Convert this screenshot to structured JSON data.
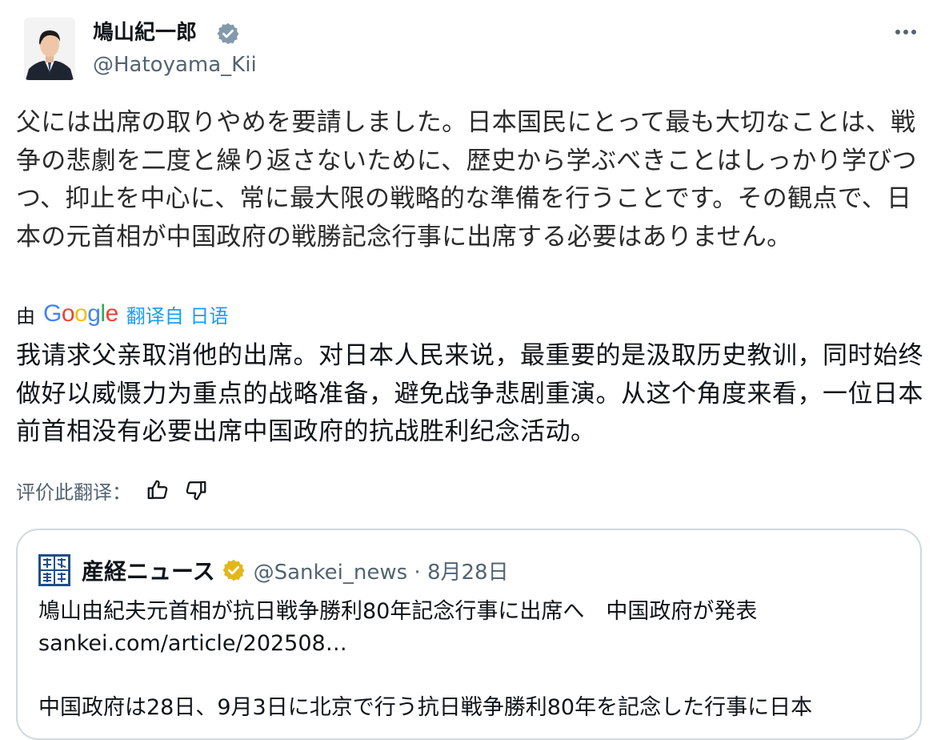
{
  "author": {
    "name": "鳩山紀一郎",
    "handle": "@Hatoyama_Kii"
  },
  "tweet": {
    "text": "父には出席の取りやめを要請しました。日本国民にとって最も大切なことは、戦争の悲劇を二度と繰り返さないために、歴史から学ぶべきことはしっかり学びつつ、抑止を中心に、常に最大限の戦略的な準備を行うことです。その観点で、日本の元首相が中国政府の戦勝記念行事に出席する必要はありません。",
    "translation_prefix": "由",
    "translation_provider": "Google",
    "translation_source": "翻译自 日语",
    "translated_text": "我请求父亲取消他的出席。对日本人民来说，最重要的是汲取历史教训，同时始终做好以威慑力为重点的战略准备，避免战争悲剧重演。从这个角度来看，一位日本前首相没有必要出席中国政府的抗战胜利纪念活动。",
    "rate_label": "评价此翻译："
  },
  "quote": {
    "name": "産経ニュース",
    "meta": "@Sankei_news · 8月28日",
    "line1": "鳩山由紀夫元首相が抗日戦争勝利80年記念行事に出席へ　中国政府が発表",
    "line2": "sankei.com/article/202508…",
    "line3": "中国政府は28日、9月3日に北京で行う抗日戦争勝利80年を記念した行事に日本"
  },
  "icons": {
    "verified": "verified-badge-icon",
    "gold_verified": "gold-verified-badge-icon",
    "more": "more-dots-icon",
    "thumbs_up": "thumbs-up-icon",
    "thumbs_down": "thumbs-down-icon"
  },
  "colors": {
    "link_blue": "#1d9bf0",
    "secondary_text": "#536471",
    "verified_gray": "#829aab",
    "gold_badge": "#e2b719"
  }
}
